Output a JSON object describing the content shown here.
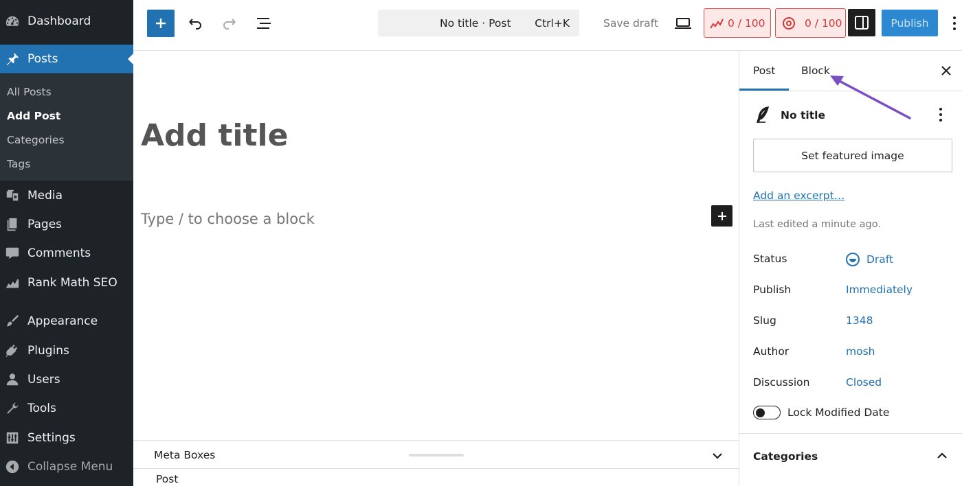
{
  "sidebar": {
    "dashboard": "Dashboard",
    "posts": "Posts",
    "submenu": {
      "all_posts": "All Posts",
      "add_post": "Add Post",
      "categories": "Categories",
      "tags": "Tags"
    },
    "media": "Media",
    "pages": "Pages",
    "comments": "Comments",
    "rank_math": "Rank Math SEO",
    "appearance": "Appearance",
    "plugins": "Plugins",
    "users": "Users",
    "tools": "Tools",
    "settings": "Settings",
    "collapse": "Collapse Menu"
  },
  "toolbar": {
    "command_title": "No title · Post",
    "command_shortcut": "Ctrl+K",
    "save_draft": "Save draft",
    "seo_score": "0 / 100",
    "content_score": "0 / 100",
    "publish": "Publish",
    "accent": "#2271b1"
  },
  "editor": {
    "title_placeholder": "Add title",
    "block_placeholder": "Type / to choose a block"
  },
  "metaboxes": {
    "label": "Meta Boxes",
    "breadcrumb": "Post"
  },
  "settings_panel": {
    "tabs": {
      "post": "Post",
      "block": "Block"
    },
    "doc_title": "No title",
    "featured_image": "Set featured image",
    "excerpt": "Add an excerpt…",
    "last_edited": "Last edited a minute ago.",
    "status_label": "Status",
    "status_value": "Draft",
    "publish_label": "Publish",
    "publish_value": "Immediately",
    "slug_label": "Slug",
    "slug_value": "1348",
    "author_label": "Author",
    "author_value": "mosh",
    "discussion_label": "Discussion",
    "discussion_value": "Closed",
    "lock_modified": "Lock Modified Date",
    "categories": "Categories"
  }
}
